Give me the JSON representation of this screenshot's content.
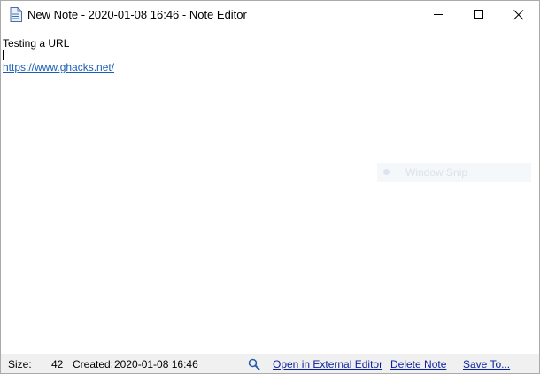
{
  "window": {
    "title": "New Note - 2020-01-08 16:46 - Note Editor"
  },
  "note": {
    "line1": "Testing a URL",
    "url": "https://www.ghacks.net/"
  },
  "overlay": {
    "label": "Window Snip"
  },
  "status": {
    "size_label": "Size:",
    "size_value": "42",
    "created_label": "Created:",
    "created_value": "2020-01-08 16:46",
    "open_external": "Open in External Editor",
    "delete": "Delete Note",
    "save": "Save To..."
  },
  "colors": {
    "link": "#1a5fb4",
    "status_link": "#0a1f9c",
    "statusbar_bg": "#f0f0f0"
  },
  "icons": [
    "note-icon",
    "minimize-icon",
    "maximize-icon",
    "close-icon",
    "search-icon"
  ]
}
